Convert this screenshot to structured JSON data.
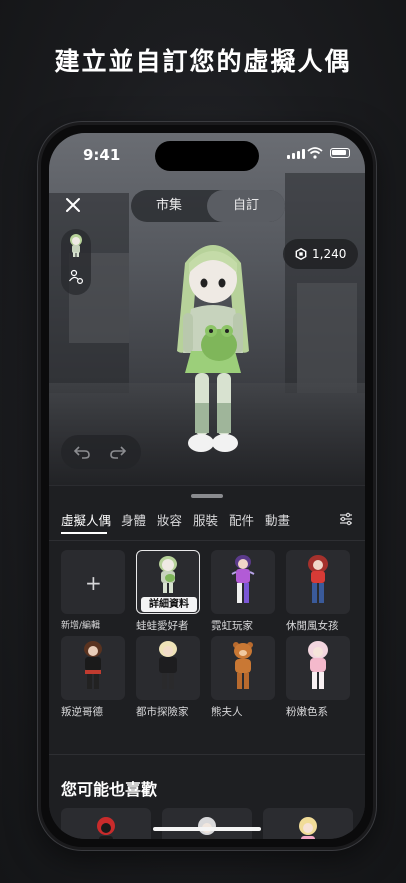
{
  "headline": "建立並自訂您的虛擬人偶",
  "status_bar": {
    "time": "9:41"
  },
  "top_tabs": [
    {
      "label": "市集",
      "active": false
    },
    {
      "label": "自訂",
      "active": true
    }
  ],
  "currency": {
    "amount": "1,240",
    "icon": "robux-icon"
  },
  "categories": [
    {
      "label": "虛擬人偶",
      "active": true
    },
    {
      "label": "身體",
      "active": false
    },
    {
      "label": "妝容",
      "active": false
    },
    {
      "label": "服裝",
      "active": false
    },
    {
      "label": "配件",
      "active": false
    },
    {
      "label": "動畫",
      "active": false
    }
  ],
  "avatars": [
    {
      "label": "新增/編輯",
      "type": "add"
    },
    {
      "label": "蛙蛙愛好者",
      "selected": true,
      "badge": "詳細資料"
    },
    {
      "label": "霓虹玩家"
    },
    {
      "label": "休閒風女孩"
    },
    {
      "label": "叛逆哥德"
    },
    {
      "label": "都市探險家"
    },
    {
      "label": "熊夫人"
    },
    {
      "label": "粉嫩色系"
    }
  ],
  "recommendations": {
    "title": "您可能也喜歡"
  },
  "colors": {
    "accent": "#ffffff",
    "sheet_bg": "#1e1f22",
    "tile_bg": "#2a2b2f"
  }
}
